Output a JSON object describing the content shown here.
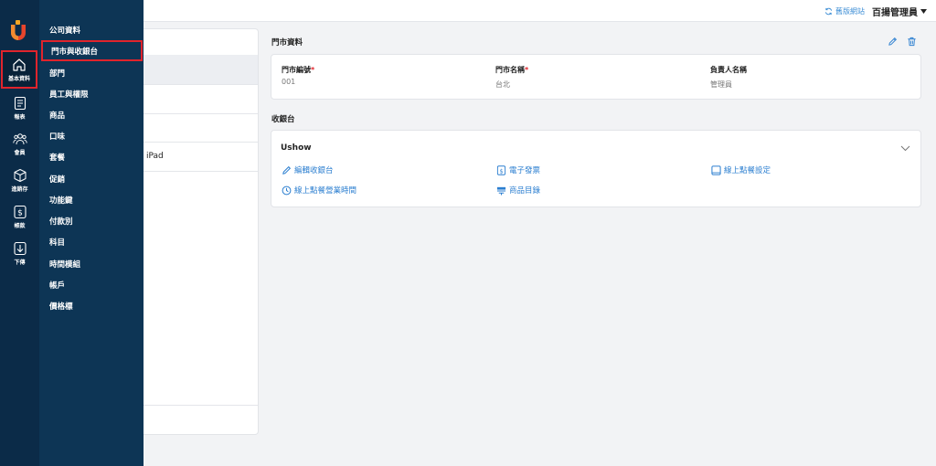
{
  "topbar": {
    "old_site_label": "舊版網站",
    "user_name": "百揚管理員"
  },
  "rail": {
    "items": [
      {
        "label": "基本資料",
        "icon": "home-icon"
      },
      {
        "label": "報表",
        "icon": "report-icon"
      },
      {
        "label": "會員",
        "icon": "members-icon"
      },
      {
        "label": "進銷存",
        "icon": "box-icon"
      },
      {
        "label": "帳款",
        "icon": "dollar-icon"
      },
      {
        "label": "下傳",
        "icon": "download-icon"
      }
    ]
  },
  "submenu": {
    "items": [
      {
        "label": "公司資料"
      },
      {
        "label": "門市與收銀台"
      },
      {
        "label": "部門"
      },
      {
        "label": "員工與權限"
      },
      {
        "label": "商品"
      },
      {
        "label": "口味"
      },
      {
        "label": "套餐"
      },
      {
        "label": "促銷"
      },
      {
        "label": "功能鍵"
      },
      {
        "label": "付款別"
      },
      {
        "label": "科目"
      },
      {
        "label": "時間模組"
      },
      {
        "label": "帳戶"
      },
      {
        "label": "價格標"
      }
    ]
  },
  "list_panel": {
    "device_text": "iPad"
  },
  "store": {
    "section_title": "門市資料",
    "fields": [
      {
        "label": "門市編號",
        "value": "001"
      },
      {
        "label": "門市名稱",
        "value": "台北"
      },
      {
        "label": "負責人名稱",
        "value": "管理員"
      }
    ]
  },
  "pos": {
    "section_title": "收銀台",
    "name": "Ushow",
    "links": {
      "edit": "編輯收銀台",
      "einvoice": "電子發票",
      "online_order_settings": "線上點餐設定",
      "online_order_hours": "線上點餐營業時間",
      "product_catalog": "商品目錄"
    }
  },
  "colors": {
    "accent": "#2c7fd0",
    "rail_bg": "#0b2b48",
    "submenu_bg": "#0d3555",
    "highlight": "#e0242c"
  }
}
